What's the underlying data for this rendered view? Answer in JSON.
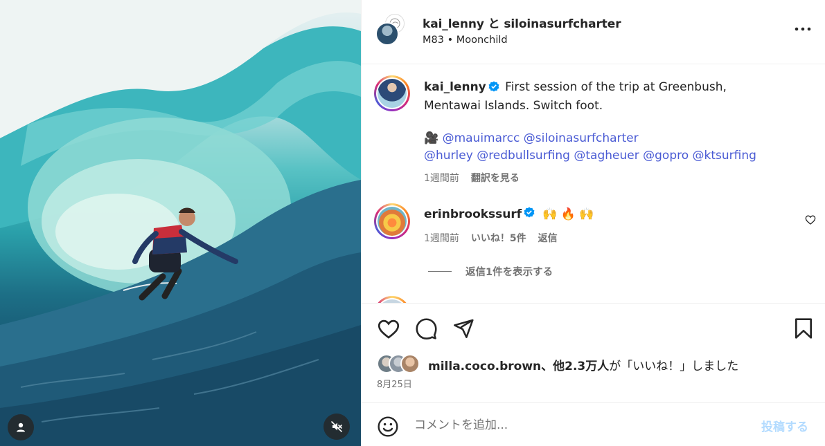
{
  "header": {
    "title": "kai_lenny と siloinasurfcharter",
    "audio": "M83 • Moonchild"
  },
  "caption": {
    "username": "kai_lenny",
    "text": "First session of the trip at Greenbush, Mentawai Islands. Switch foot.",
    "camera_emoji": "🎥",
    "mentions": [
      "@mauimarcc",
      "@siloinasurfcharter",
      "@hurley",
      "@redbullsurfing",
      "@tagheuer",
      "@gopro",
      "@ktsurfing"
    ],
    "time": "1週間前",
    "translate": "翻訳を見る"
  },
  "comment1": {
    "username": "erinbrookssurf",
    "text": "🙌 🔥 🙌",
    "time": "1週間前",
    "likes": "いいね！5件",
    "reply": "返信",
    "view_replies": "返信1件を表示する"
  },
  "likes": {
    "name": "milla.coco.brown",
    "text_middle": "、他",
    "count": "2.3万人",
    "text_end": "が「いいね！」しました"
  },
  "date": "8月25日",
  "comment_box": {
    "placeholder": "コメントを追加...",
    "post": "投稿する"
  },
  "colors": {
    "link": "#4a5bd4",
    "verified": "#0095f6",
    "post_disabled": "#b3dbff"
  }
}
